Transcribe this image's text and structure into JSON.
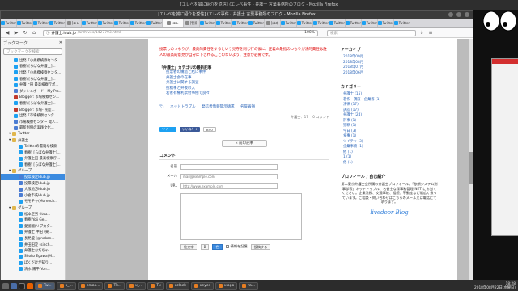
{
  "os": {
    "window_title": "[エレベを誠に紹介を返信] (エレベ事件 - 弁護士 言葉事務所のブログ - Mozilla Firefox"
  },
  "firefox": {
    "titlebar": "[エレベを誠に紹介を返信] (エレベ事件 - 弁護士 言葉事務所のブログ - Mozilla Firefox",
    "tabs": [
      "Twitter",
      "Twitter",
      "Twitter",
      "Twitter",
      "[エレ",
      "Twitter",
      "Twitter",
      "Twitter",
      "Twitter",
      "Twitter",
      "[エレ",
      "[警察",
      "Twitter",
      "Twitter",
      "Twitter",
      "Twitter",
      "[はぬ",
      "Twitter",
      "Twitter",
      "Twitter",
      "Twitter",
      "Twitter",
      "Twitter",
      "Twitter",
      "Twitter"
    ],
    "url_host": "弁護士.ldub.jp",
    "url_path": "/archives/1427793.html",
    "search_placeholder": "検索",
    "zoom": "100%"
  },
  "sidebar": {
    "title": "ブックマーク",
    "search_placeholder": "ブックマークを検索",
    "items": [
      {
        "label": "出発「小規模検察センタ...",
        "type": "item",
        "icon": "twitter"
      },
      {
        "label": "春樹\\ [らばな弁護士]...",
        "type": "item",
        "icon": "twitter"
      },
      {
        "label": "出発「小規模検察センタ...",
        "type": "item",
        "icon": "twitter"
      },
      {
        "label": "春樹\\ [らばな弁護士]...",
        "type": "item",
        "icon": "twitter"
      },
      {
        "label": "弁護上田 最高検察庁ポ...",
        "type": "item",
        "icon": "twitter"
      },
      {
        "label": "ダッシュボード - My Pro...",
        "type": "item",
        "icon": "web"
      },
      {
        "label": "Blogger: 市場検察セン...",
        "type": "item",
        "icon": "red"
      },
      {
        "label": "春樹\\ [らばな弁護士]...",
        "type": "item",
        "icon": "twitter"
      },
      {
        "label": "Blogger: 市場- 民陸...",
        "type": "item",
        "icon": "red"
      },
      {
        "label": "出発「市場検察センタ...",
        "type": "item",
        "icon": "twitter"
      },
      {
        "label": "市場検察センター 発人...",
        "type": "item",
        "icon": "web"
      },
      {
        "label": "最新判例の実践文化...",
        "type": "item",
        "icon": "web"
      },
      {
        "label": "Twitter",
        "type": "folder",
        "icon": "folder"
      },
      {
        "label": "弁護士",
        "type": "folder",
        "icon": "folder"
      },
      {
        "label": "Twitterの書籍な検索",
        "type": "sub",
        "icon": "twitter"
      },
      {
        "label": "春樹\\ [らばな弁護士]...",
        "type": "sub",
        "icon": "twitter"
      },
      {
        "label": "弁護上田 最高検察庁...",
        "type": "sub",
        "icon": "twitter"
      },
      {
        "label": "春樹\\ [らばな弁護士]...",
        "type": "sub",
        "icon": "twitter"
      },
      {
        "label": "グループ",
        "type": "folder",
        "icon": "folder"
      },
      {
        "label": "投票検定ldub.jp",
        "type": "sub",
        "icon": "web",
        "selected": true
      },
      {
        "label": "投票検定ldub.jp",
        "type": "sub",
        "icon": "web"
      },
      {
        "label": "大阪地方ldub.ju",
        "type": "sub",
        "icon": "web"
      },
      {
        "label": "小倉市氏ldub.jp",
        "type": "sub",
        "icon": "web"
      },
      {
        "label": "モモチャ(Momoch...",
        "type": "sub",
        "icon": "twitter"
      },
      {
        "label": "グループ",
        "type": "folder",
        "icon": "folder"
      },
      {
        "label": "松本正男 (itsu...",
        "type": "sub",
        "icon": "twitter"
      },
      {
        "label": "春樹 Yoji Ge...",
        "type": "sub",
        "icon": "twitter"
      },
      {
        "label": "愛國國(リブカタ...",
        "type": "sub",
        "icon": "twitter"
      },
      {
        "label": "弁護士 中田 (東...",
        "type": "sub",
        "icon": "twitter"
      },
      {
        "label": "長見優 (@nakan...",
        "type": "sub",
        "icon": "twitter"
      },
      {
        "label": "井田田淀 (sinch...",
        "type": "sub",
        "icon": "twitter"
      },
      {
        "label": "弁護士おだちゃ...",
        "type": "sub",
        "icon": "twitter"
      },
      {
        "label": "Shoko Egawa(M...",
        "type": "sub",
        "icon": "twitter"
      },
      {
        "label": "ぼくだけが知り...",
        "type": "sub",
        "icon": "twitter"
      },
      {
        "label": "清水 陽平(Yoh...",
        "type": "sub",
        "icon": "twitter"
      }
    ]
  },
  "article": {
    "red_text": "投票しのつもりが、最良的責任をするという見守を同じ行の後に、正義の最指のつもりが法的責任は誰人の最高的意見が自分に下されることのないよう、注意が必要です。",
    "related_title": "「弁護士」カテゴリの最新記事",
    "related": [
      "投票者の構造と結に事件",
      "弁護士会の在事",
      "弁護士に関する調査",
      "投稿事と弁後の入",
      "若者有権利票付事例で良々"
    ],
    "tags": [
      "ネットトラブル",
      "発信者情報開示請求",
      "名誉毀損"
    ],
    "meta_left": "弁護士：17",
    "meta_right": "0 コメント",
    "share_tweet": "ツイート",
    "share_like": "いいね！ 0",
    "share_hatena": "B! 0",
    "back_button": "« 前の記事",
    "comment_title": "コメント",
    "name_label": "名前",
    "mail_label": "メール",
    "url_label": "URL",
    "mail_placeholder": "mail@example.com",
    "url_placeholder": "http://www.example.com",
    "btn_emoji": "絵文字",
    "btn_bold": "B",
    "btn_color": "色",
    "remember_label": "情報を記憶",
    "submit": "投稿する"
  },
  "side": {
    "archive_title": "アーカイブ",
    "archives": [
      "2018年09月",
      "2018年08月",
      "2018年07月",
      "2018年06月"
    ],
    "category_title": "カテゴリー",
    "categories": [
      "弁護士 (15)",
      "著作・講演・企業等 (1)",
      "法律 (17)",
      "訴訟 (17)",
      "弁護士 (24)",
      "刑事 (1)",
      "犯罪 (1)",
      "今日 (3)",
      "食事 (1)",
      "ツイテキ (3)",
      "企業事務 (1)",
      "他 (1)",
      "1 (1)",
      "他 (1)"
    ],
    "profile_title": "プロフィール / 自己紹介",
    "profile_text": "第二東京弁護士会所属の弁護士プロフィール。「依頼システム刑事部等」ネットトラブル、名誉主な保事務管理(NET)にお当てください。企業法務、交通事故、相続、不動産など幅広く扱っています。ご相談・問い合わせはこちらのメール又は電話にて承ります。",
    "logo": "livedoor Blog"
  },
  "taskbar": {
    "tasks": [
      "Tw...",
      "x_...",
      "emac...",
      "Tk...",
      "x_...",
      "Tk",
      "xclock",
      "xeyes",
      "xlogo",
      "ra..."
    ],
    "time": "18:28",
    "date": "2018年08月22日(水曜日)"
  }
}
